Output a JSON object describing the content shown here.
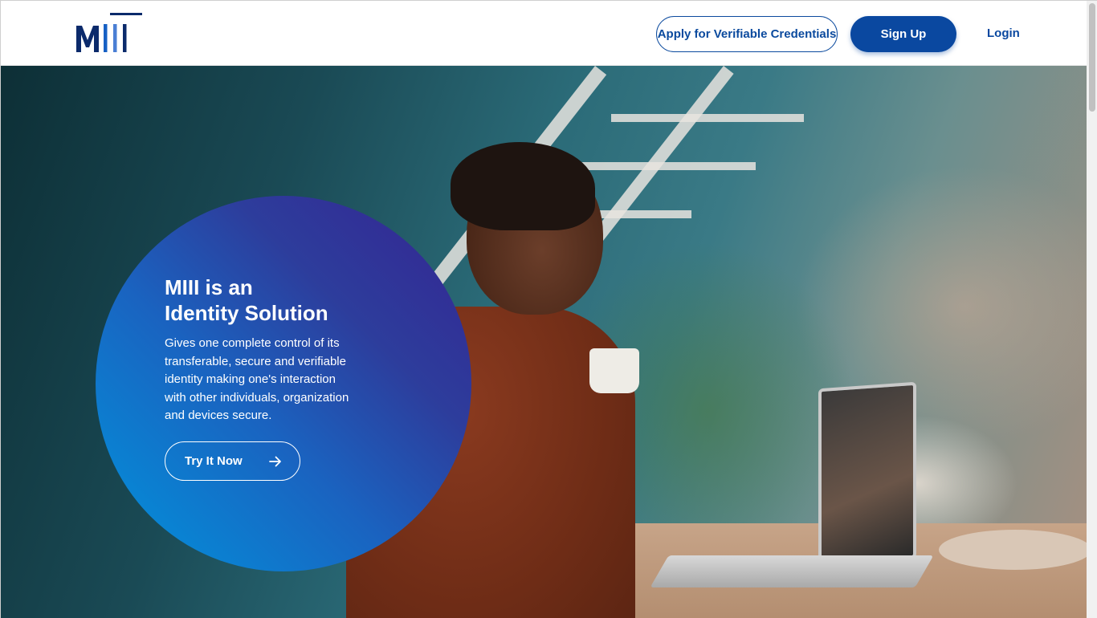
{
  "header": {
    "logo_text": "MIII",
    "apply_label": "Apply for Verifiable Credentials",
    "signup_label": "Sign Up",
    "login_label": "Login"
  },
  "hero": {
    "title_line1": "MIII is an",
    "title_line2": "Identity Solution",
    "description": "Gives one complete control of its transferable, secure and verifiable identity making one's interaction with other individuals, organization and devices secure.",
    "cta_label": "Try It Now",
    "cta_icon": "arrow-right-icon",
    "image_subject": "woman-drinking-coffee-at-laptop-photo"
  },
  "colors": {
    "brand_navy": "#0b2a6b",
    "primary_blue": "#0a48a0",
    "circle_start": "#0095dd",
    "circle_end": "#352391",
    "white": "#ffffff"
  }
}
